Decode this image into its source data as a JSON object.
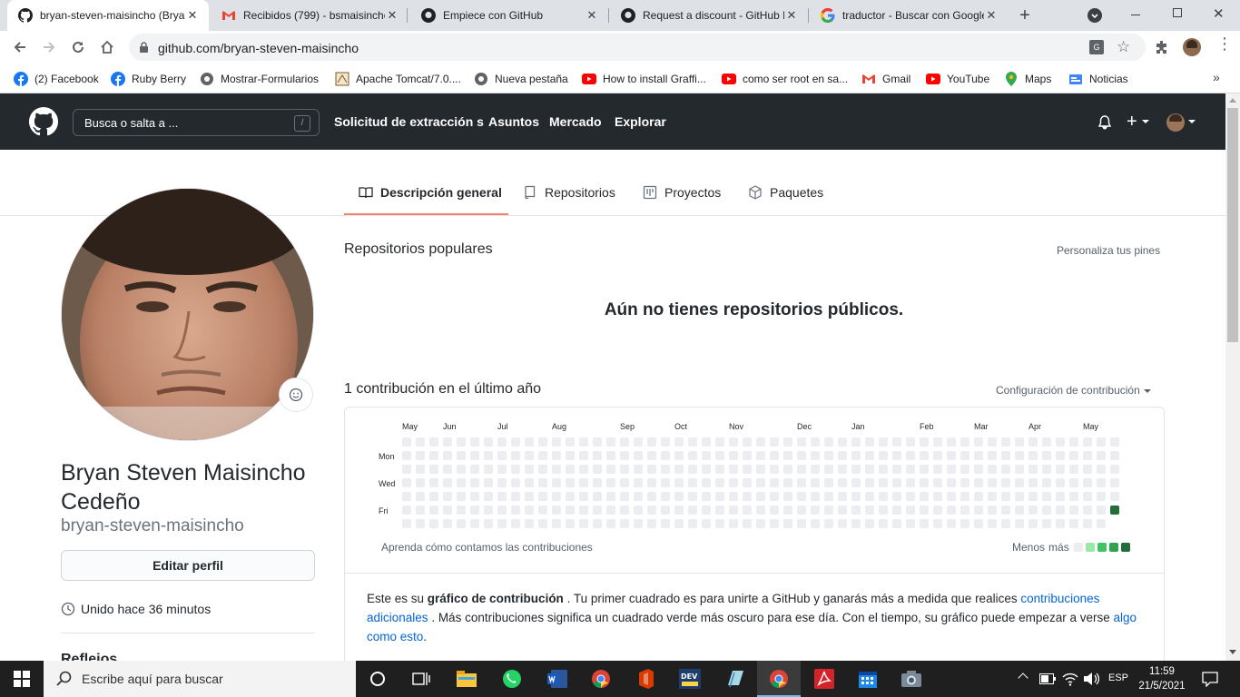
{
  "browser": {
    "tabs": [
      {
        "title": "bryan-steven-maisincho (Bryan",
        "icon": "github-icon",
        "active": true
      },
      {
        "title": "Recibidos (799) - bsmaisincho",
        "icon": "gmail-icon",
        "active": false
      },
      {
        "title": "Empiece con GitHub",
        "icon": "github-icon",
        "active": false
      },
      {
        "title": "Request a discount - GitHub E",
        "icon": "github-icon",
        "active": false
      },
      {
        "title": "traductor - Buscar con Google",
        "icon": "google-icon",
        "active": false
      }
    ],
    "url": "github.com/bryan-steven-maisincho",
    "bookmarks": [
      {
        "label": "(2) Facebook",
        "icon": "facebook-icon"
      },
      {
        "label": "Ruby Berry",
        "icon": "facebook-icon"
      },
      {
        "label": "Mostrar-Formularios",
        "icon": "globe-icon"
      },
      {
        "label": "Apache Tomcat/7.0....",
        "icon": "tomcat-icon"
      },
      {
        "label": "Nueva pestaña",
        "icon": "globe-icon"
      },
      {
        "label": "How to install Graffi...",
        "icon": "youtube-icon"
      },
      {
        "label": "como ser root en sa...",
        "icon": "youtube-icon"
      },
      {
        "label": "Gmail",
        "icon": "gmail-icon"
      },
      {
        "label": "YouTube",
        "icon": "youtube-icon"
      },
      {
        "label": "Maps",
        "icon": "maps-icon"
      },
      {
        "label": "Noticias",
        "icon": "news-icon"
      }
    ]
  },
  "github": {
    "search_placeholder": "Busca o salta a ...",
    "search_shortcut": "/",
    "nav": [
      "Solicitud de extracción s",
      "Asuntos",
      "Mercado",
      "Explorar"
    ],
    "profile_tabs": [
      "Descripción general",
      "Repositorios",
      "Proyectos",
      "Paquetes"
    ],
    "active_tab": "Descripción general"
  },
  "profile": {
    "full_name": "Bryan Steven Maisincho Cedeño",
    "username": "bryan-steven-maisincho",
    "edit_button": "Editar perfil",
    "joined": "Unido hace 36 minutos",
    "section_highlights": "Reflejos"
  },
  "main": {
    "popular_title": "Repositorios populares",
    "customize_pins": "Personaliza tus pines",
    "no_repos": "Aún no tienes repositorios públicos.",
    "contrib_count": "1 contribución en el último año",
    "contrib_settings": "Configuración de contribución",
    "learn_link": "Aprenda cómo contamos las contribuciones",
    "legend_less": "Menos",
    "legend_more": "más",
    "desc_p1": "Este es su",
    "desc_bold": "gráfico de contribución",
    "desc_p2": ". Tu primer cuadrado es para unirte a GitHub y ganarás más a medida que realices",
    "desc_link1": "contribuciones adicionales",
    "desc_p3": ". Más contribuciones significa un cuadrado verde más oscuro para ese día. Con el tiempo, su gráfico puede empezar a verse",
    "desc_link2": "algo como esto",
    "desc_p4": "."
  },
  "chart_data": {
    "type": "heatmap",
    "months": [
      "May",
      "Jun",
      "Jul",
      "Aug",
      "Sep",
      "Oct",
      "Nov",
      "Dec",
      "Jan",
      "Feb",
      "Mar",
      "Apr",
      "May"
    ],
    "day_labels": [
      "Mon",
      "Wed",
      "Fri"
    ],
    "weeks": 53,
    "last_week_days": 6,
    "contributions": [
      {
        "week": 53,
        "day": 5,
        "count": 1
      }
    ],
    "colors": {
      "empty": "#ebedf0",
      "levels": [
        "#9be9a8",
        "#40c463",
        "#30a14e",
        "#216e39"
      ]
    }
  },
  "taskbar": {
    "search_placeholder": "Escribe aquí para buscar",
    "language": "ESP",
    "time": "11:59",
    "date": "21/5/2021"
  }
}
